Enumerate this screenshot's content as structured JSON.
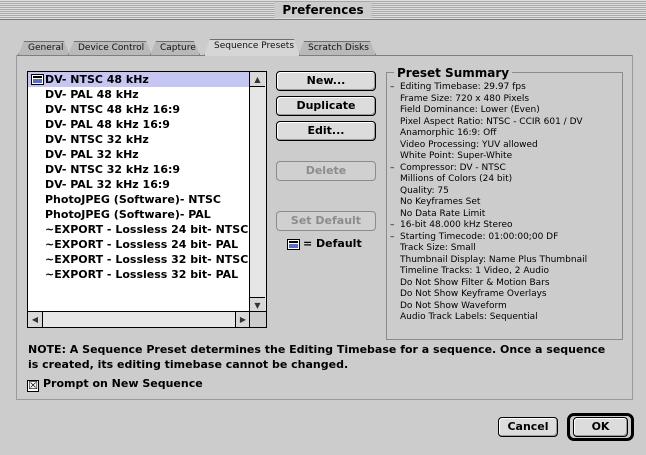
{
  "window": {
    "title": "Preferences"
  },
  "tabs": [
    {
      "label": "General"
    },
    {
      "label": "Device Control"
    },
    {
      "label": "Capture"
    },
    {
      "label": "Sequence Presets",
      "active": true
    },
    {
      "label": "Scratch Disks"
    }
  ],
  "presets": [
    {
      "label": "DV- NTSC 48 kHz",
      "selected": true,
      "default": true
    },
    {
      "label": "DV- PAL  48 kHz"
    },
    {
      "label": "DV- NTSC 48 kHz 16:9"
    },
    {
      "label": "DV- PAL  48 kHz 16:9"
    },
    {
      "label": "DV- NTSC 32 kHz"
    },
    {
      "label": "DV- PAL  32 kHz"
    },
    {
      "label": "DV- NTSC 32 kHz 16:9"
    },
    {
      "label": "DV- PAL  32 kHz 16:9"
    },
    {
      "label": "PhotoJPEG (Software)- NTSC"
    },
    {
      "label": "PhotoJPEG (Software)- PAL"
    },
    {
      "label": "~EXPORT - Lossless 24 bit- NTSC"
    },
    {
      "label": "~EXPORT - Lossless 24 bit- PAL"
    },
    {
      "label": "~EXPORT - Lossless 32 bit- NTSC"
    },
    {
      "label": "~EXPORT - Lossless 32 bit- PAL"
    }
  ],
  "buttons": {
    "new": "New...",
    "duplicate": "Duplicate",
    "edit": "Edit...",
    "delete": "Delete",
    "set_default": "Set Default",
    "cancel": "Cancel",
    "ok": "OK"
  },
  "default_legend": "= Default",
  "summary": {
    "title": "Preset Summary",
    "lines": [
      {
        "text": "Editing Timebase: 29.97 fps",
        "bullet": true
      },
      {
        "text": "Frame Size: 720 x 480 Pixels"
      },
      {
        "text": "Field Dominance: Lower (Even)"
      },
      {
        "text": "Pixel Aspect Ratio: NTSC - CCIR 601 / DV"
      },
      {
        "text": "Anamorphic 16:9: Off"
      },
      {
        "text": "Video Processing: YUV allowed"
      },
      {
        "text": "White Point: Super-White"
      },
      {
        "text": "Compressor: DV - NTSC",
        "bullet": true
      },
      {
        "text": "Millions of Colors (24 bit)"
      },
      {
        "text": "Quality: 75"
      },
      {
        "text": "No Keyframes Set"
      },
      {
        "text": "No Data Rate Limit"
      },
      {
        "text": "16-bit 48.000 kHz Stereo",
        "bullet": true
      },
      {
        "text": "Starting Timecode: 01:00:00;00 DF",
        "bullet": true
      },
      {
        "text": "Track Size: Small"
      },
      {
        "text": "Thumbnail Display: Name Plus Thumbnail"
      },
      {
        "text": "Timeline Tracks: 1 Video, 2 Audio"
      },
      {
        "text": "Do Not Show Filter & Motion Bars"
      },
      {
        "text": "Do Not Show Keyframe Overlays"
      },
      {
        "text": "Do Not Show Waveform"
      },
      {
        "text": "Audio Track Labels: Sequential"
      }
    ]
  },
  "note": "NOTE: A Sequence Preset determines the Editing Timebase for a sequence. Once a sequence is created, its editing timebase cannot be changed.",
  "prompt_checkbox": {
    "label": "Prompt on New Sequence",
    "checked": true,
    "mark": "☒"
  },
  "icons": {
    "scroll_up": "▲",
    "scroll_down": "▼",
    "scroll_left": "◀",
    "scroll_right": "▶"
  }
}
